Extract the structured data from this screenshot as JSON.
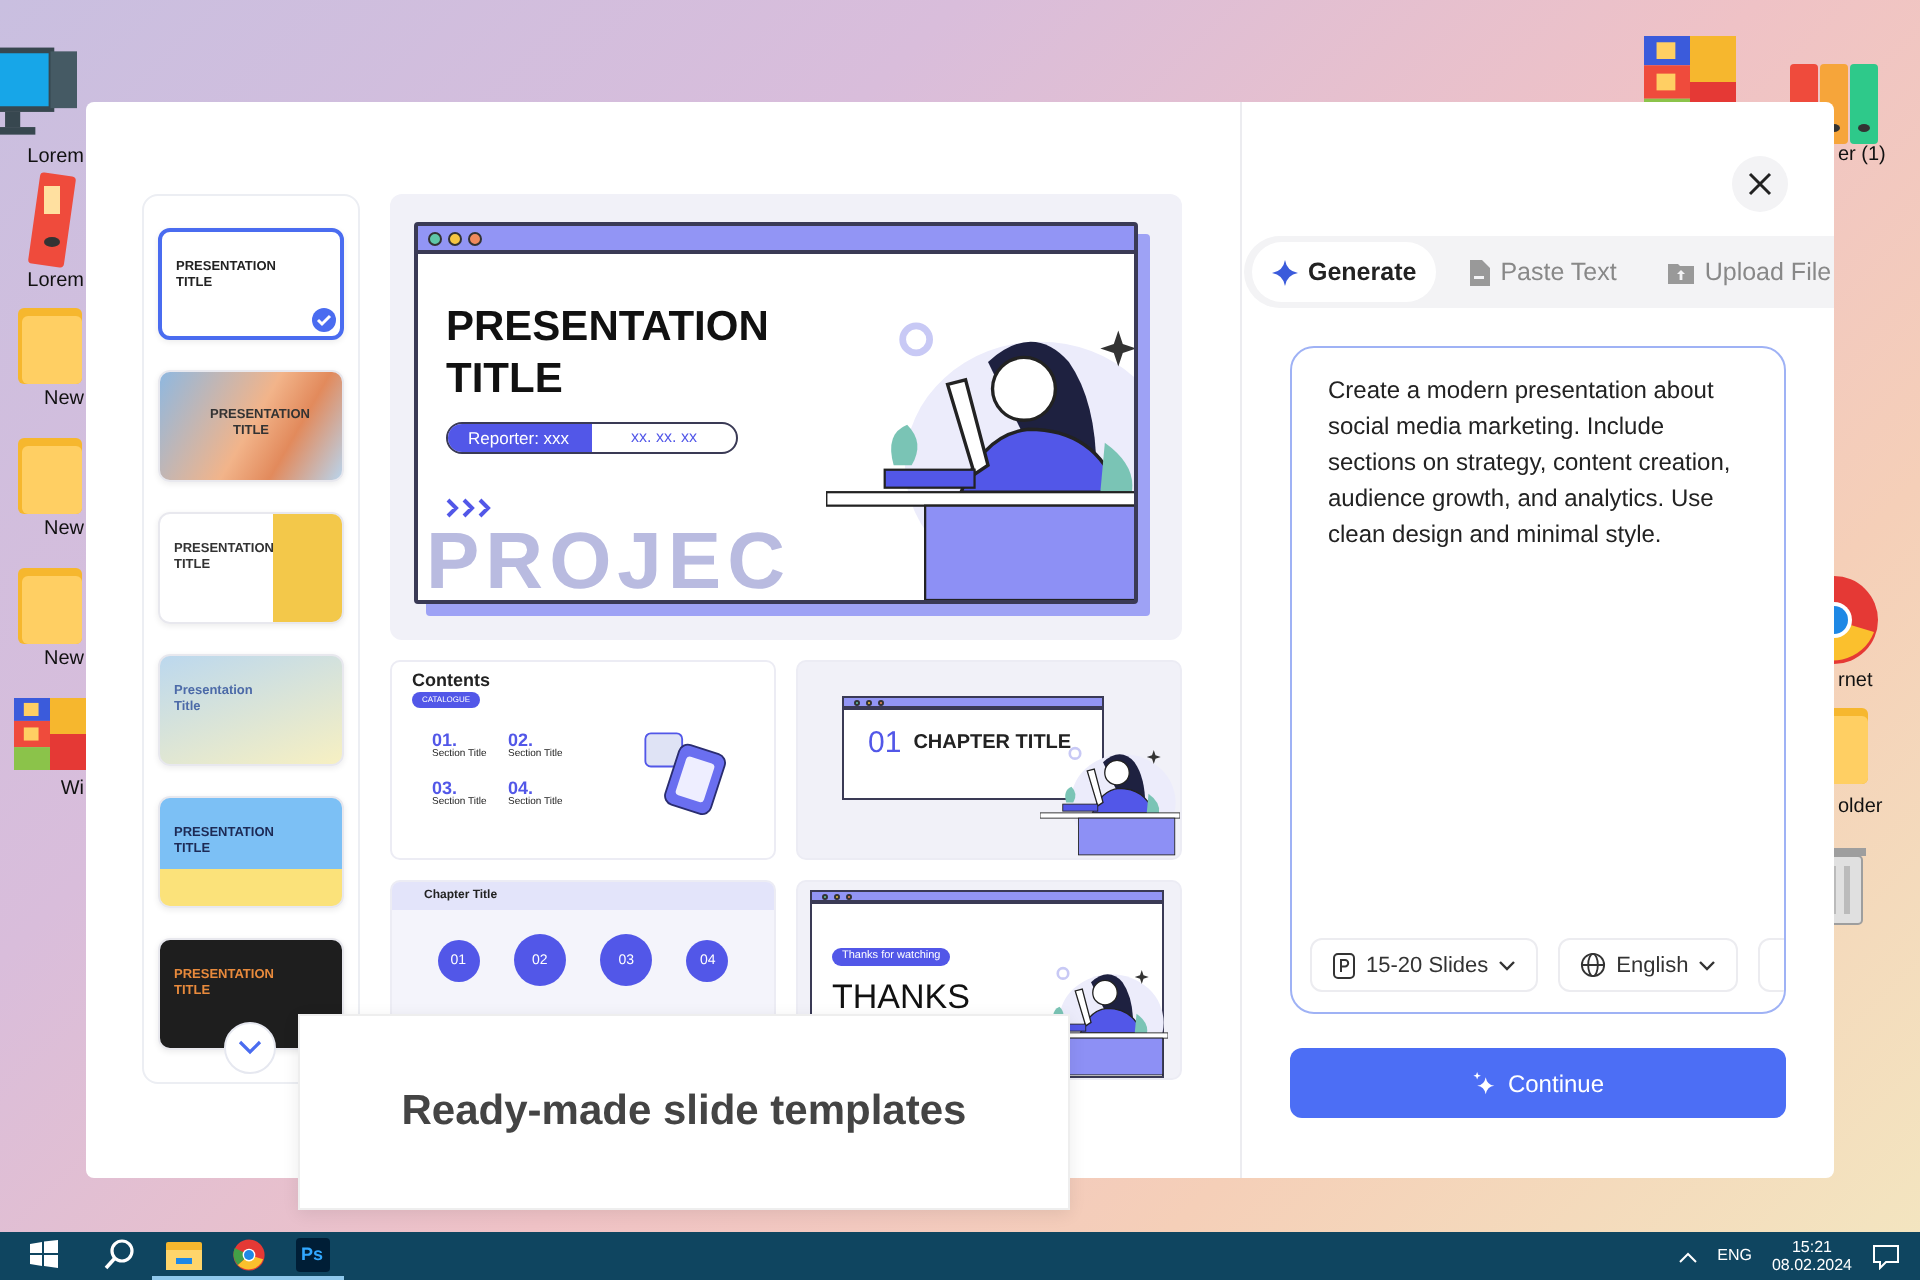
{
  "desktop": {
    "left_icons": [
      {
        "kind": "computer",
        "label": "Lorem"
      },
      {
        "kind": "binder",
        "label": "Lorem"
      },
      {
        "kind": "folder",
        "label": "New"
      },
      {
        "kind": "folder",
        "label": "New"
      },
      {
        "kind": "folder",
        "label": "New"
      },
      {
        "kind": "apps",
        "label": "Wi"
      }
    ],
    "right_icons": [
      {
        "kind": "apps"
      },
      {
        "kind": "binders",
        "label": "er (1)"
      },
      {
        "kind": "browser",
        "label": "rnet"
      },
      {
        "kind": "folder",
        "label": "older"
      },
      {
        "kind": "trash"
      }
    ]
  },
  "templates": {
    "thumbnails": [
      {
        "kind": "classroom",
        "title": "PRESENTATION TITLE",
        "selected": true
      },
      {
        "kind": "gradient",
        "title": "PRESENTATION TITLE",
        "selected": false
      },
      {
        "kind": "photo",
        "title": "PRESENTATION TITLE",
        "selected": false
      },
      {
        "kind": "mountain",
        "title": "Presentation Title",
        "selected": false
      },
      {
        "kind": "people",
        "title": "PRESENTATION TITLE",
        "selected": false
      },
      {
        "kind": "dark",
        "title": "PRESENTATION TITLE",
        "selected": false
      }
    ],
    "cover_slide": {
      "title": "PRESENTATION TITLE",
      "reporter": "Reporter: xxx",
      "date": "xx. xx. xx",
      "watermark": "PROJEC"
    },
    "contents_slide": {
      "title": "Contents",
      "tag": "CATALOGUE",
      "sections": [
        {
          "number": "01.",
          "label": "Section Title"
        },
        {
          "number": "02.",
          "label": "Section Title"
        },
        {
          "number": "03.",
          "label": "Section Title"
        },
        {
          "number": "04.",
          "label": "Section Title"
        }
      ]
    },
    "chapter_slide": {
      "number": "01",
      "title": "CHAPTER TITLE"
    },
    "timeline_slide": {
      "title": "Chapter Title",
      "steps": [
        "01",
        "02",
        "03",
        "04"
      ]
    },
    "thanks_slide": {
      "tag": "Thanks for watching",
      "title": "THANKS"
    }
  },
  "caption": "Ready-made slide templates",
  "panel": {
    "tabs": [
      {
        "kind": "generate",
        "label": "Generate",
        "selected": true
      },
      {
        "kind": "paste",
        "label": "Paste Text",
        "selected": false
      },
      {
        "kind": "upload",
        "label": "Upload File",
        "selected": false
      }
    ],
    "prompt": "Create a modern presentation about social media marketing. Include sections on strategy, content creation, audience growth, and analytics. Use clean design and minimal style.",
    "options": [
      {
        "kind": "slides",
        "label": "15-20 Slides"
      },
      {
        "kind": "language",
        "label": "English"
      },
      {
        "kind": "more"
      }
    ],
    "continue": "Continue"
  },
  "taskbar": {
    "apps": [
      {
        "kind": "explorer",
        "open": true
      },
      {
        "kind": "browser",
        "open": true
      },
      {
        "kind": "photoshop",
        "label": "Ps",
        "open": true
      }
    ],
    "language": "ENG",
    "time": "15:21",
    "date": "08.02.2024"
  }
}
